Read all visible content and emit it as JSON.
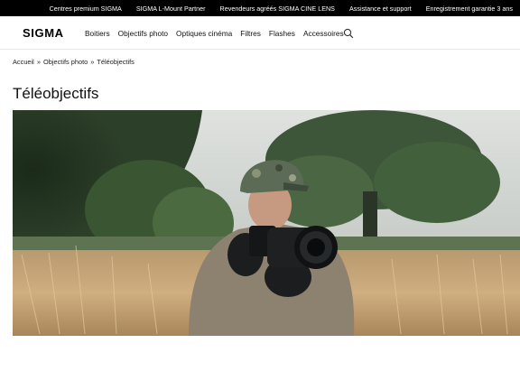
{
  "topbar": {
    "links": [
      "Centres premium SIGMA",
      "SIGMA L-Mount Partner",
      "Revendeurs agréés SIGMA CINE LENS",
      "Assistance et support",
      "Enregistrement garantie 3 ans"
    ]
  },
  "header": {
    "logo": "SIGMA",
    "menu": [
      "Boitiers",
      "Objectifs photo",
      "Optiques cinéma",
      "Filtres",
      "Flashes",
      "Accessoires"
    ],
    "search_icon": "search-icon"
  },
  "breadcrumb": {
    "items": [
      "Accueil",
      "Objectifs photo",
      "Téléobjectifs"
    ],
    "separator": "»"
  },
  "page": {
    "title": "Téléobjectifs"
  },
  "hero": {
    "colors": {
      "sky": "#cfd3cf",
      "trees": "#2f4a2a",
      "field": "#c8a878",
      "jacket": "#8c7f6e",
      "cap": "#5a6a55"
    }
  }
}
